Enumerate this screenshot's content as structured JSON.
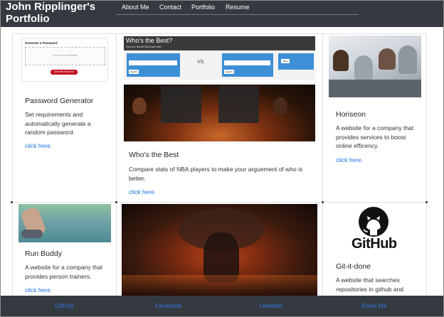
{
  "header": {
    "brand_line1": "John Ripplinger's",
    "brand_line2": "Portfolio",
    "nav": [
      "About Me",
      "Contact",
      "Portfolio",
      "Resume"
    ]
  },
  "cards": {
    "password": {
      "title": "Password Generator",
      "text": [
        "Set requirements and",
        "automatically generate a",
        "random password."
      ],
      "link": "click here.",
      "shot": {
        "heading": "Generate a Password",
        "box_text": "Your Secure Password",
        "button": "Generate Password"
      }
    },
    "whos_best": {
      "title": "Who's the Best",
      "text": [
        "Compare stats of NBA players to make your arguement of who is",
        "better."
      ],
      "link": "click here.",
      "shot": {
        "heading": "Who's the Best?",
        "sub": "View your favorite NBA player stats",
        "vs": "VS.",
        "search": "Search",
        "save": "Save"
      }
    },
    "horiseon": {
      "title": "Horiseon",
      "text": [
        "A website for a company that",
        "provides services to boost",
        "online efficency."
      ],
      "link": "click here."
    },
    "run_buddy": {
      "title": "Run Buddy",
      "text": [
        "A website for a company that",
        "provides person trainers."
      ],
      "link": "click here."
    },
    "git_it_done": {
      "title": "Git-it-done",
      "text": [
        "A website that searches",
        "repositories in github and"
      ],
      "logo_text": "GitHub"
    }
  },
  "footer": {
    "links": [
      "GitHub",
      "Facebook",
      "LinkedIn",
      "Email Me"
    ]
  },
  "colors": {
    "navbar": "#343a40",
    "link": "#1a73e8",
    "footer_link": "#2f7ae5"
  }
}
